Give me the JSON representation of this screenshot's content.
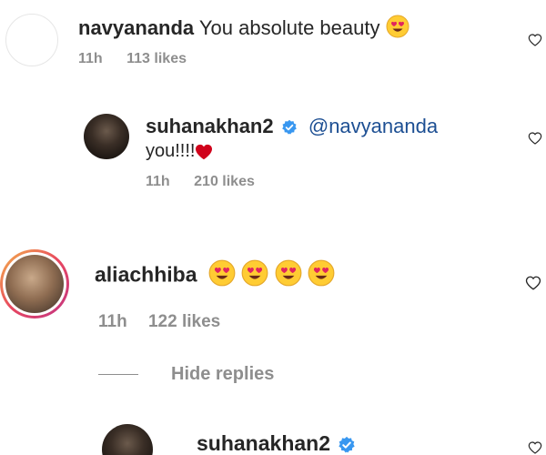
{
  "comments": [
    {
      "username": "navyananda",
      "text": "You absolute beauty",
      "emoji": "heart-eyes",
      "time": "11h",
      "likes": "113 likes"
    },
    {
      "username": "suhanakhan2",
      "mention": "@navyananda",
      "text": "you!!!!",
      "time": "11h",
      "likes": "210 likes"
    },
    {
      "username": "aliachhiba",
      "time": "11h",
      "likes": "122 likes"
    },
    {
      "username": "suhanakhan2"
    }
  ],
  "replies": {
    "hide_label": "Hide replies"
  },
  "colors": {
    "username": "#262626",
    "meta": "#8e8e8e",
    "mention": "#1d4f93",
    "verified": "#3897f0",
    "red_heart": "#d0021b",
    "emoji_face": "#ffcc33"
  }
}
